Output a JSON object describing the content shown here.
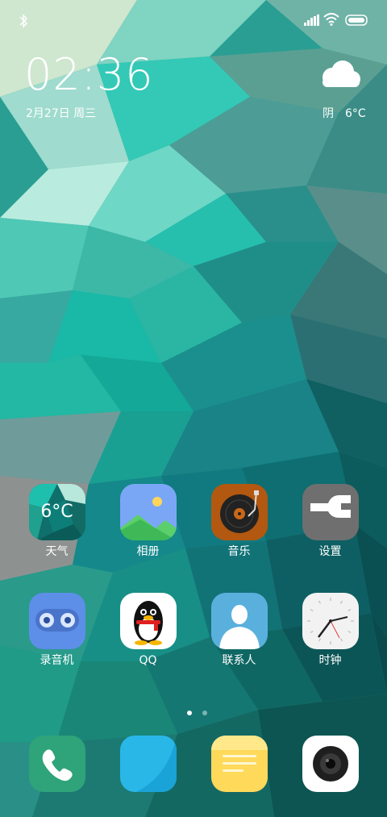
{
  "status_bar": {
    "bluetooth": "bluetooth-icon",
    "signal": "signal-icon",
    "wifi": "wifi-icon",
    "battery": "battery-icon"
  },
  "clock": {
    "time": "02:36",
    "date": "2月27日 周三"
  },
  "weather_widget": {
    "icon": "cloud-icon",
    "text": "阴　6°C"
  },
  "apps": [
    {
      "label": "天气",
      "icon": "weather-app-icon",
      "badge_text": "6°C"
    },
    {
      "label": "相册",
      "icon": "gallery-icon"
    },
    {
      "label": "音乐",
      "icon": "music-icon"
    },
    {
      "label": "设置",
      "icon": "settings-icon"
    },
    {
      "label": "录音机",
      "icon": "recorder-icon"
    },
    {
      "label": "QQ",
      "icon": "qq-icon"
    },
    {
      "label": "联系人",
      "icon": "contacts-icon"
    },
    {
      "label": "时钟",
      "icon": "clock-app-icon"
    }
  ],
  "page_indicator": {
    "pages": 2,
    "current": 1
  },
  "dock": [
    {
      "icon": "phone-icon"
    },
    {
      "icon": "messages-icon"
    },
    {
      "icon": "notes-icon"
    },
    {
      "icon": "camera-icon"
    }
  ],
  "colors": {
    "wallpaper_base": "#2fa79a",
    "accent_teal": "#1cc2b2",
    "weather_tile": "#0f6f6a",
    "gallery_bg": "#7aa7f5",
    "music_bg": "#b35810",
    "settings_bg": "#6f6f6f",
    "recorder_bg": "#5d8ee8",
    "contacts_bg": "#5ab0dd",
    "phone_bg": "#2fa37a",
    "messages_bg": "#29b7e8",
    "notes_bg": "#ffd95a"
  }
}
